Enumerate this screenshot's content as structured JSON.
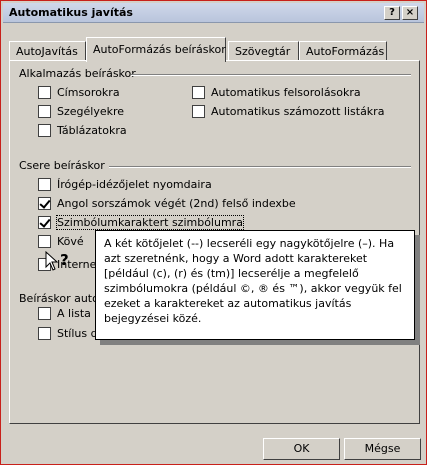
{
  "window": {
    "title": "Automatikus javítás",
    "help_glyph": "?",
    "close_glyph": "×"
  },
  "tabs": [
    {
      "label": "AutoJavítás"
    },
    {
      "label": "AutoFormázás beíráskor"
    },
    {
      "label": "Szövegtár"
    },
    {
      "label": "AutoFormázás"
    }
  ],
  "apply_group": {
    "title": "Alkalmazás beíráskor",
    "items": [
      {
        "label": "Címsorokra",
        "checked": false
      },
      {
        "label": "Automatikus felsorolásokra",
        "checked": false
      },
      {
        "label": "Szegélyekre",
        "checked": false
      },
      {
        "label": "Automatikus számozott listákra",
        "checked": false
      },
      {
        "label": "Táblázatokra",
        "checked": false
      }
    ]
  },
  "replace_group": {
    "title": "Csere beíráskor",
    "items": [
      {
        "label": "Írógép-idézőjelet nyomdaira",
        "checked": false
      },
      {
        "label": "Angol sorszámok végét (2nd) felső indexbe",
        "checked": true
      },
      {
        "label": "Szimbólumkaraktert szimbólumra",
        "checked": true
      },
      {
        "label": "Kövé",
        "checked": false
      },
      {
        "label": "Internet",
        "checked": false
      }
    ]
  },
  "typing_group": {
    "title": "Beíráskor auto",
    "items": [
      {
        "label": "A lista ke",
        "checked": false
      },
      {
        "label": "Stílus de",
        "checked": false
      }
    ]
  },
  "tooltip": {
    "text": "A két kötőjelet (--) lecseréli egy nagykötőjelre (–). Ha azt szeretnénk, hogy a Word adott karaktereket [például (c), (r) és (tm)] lecserélje a megfelelő szimbólumokra (például ©, ® és ™), akkor vegyük fel ezeket a karaktereket az automatikus javítás bejegyzései közé."
  },
  "buttons": {
    "ok": "OK",
    "cancel": "Mégse"
  }
}
